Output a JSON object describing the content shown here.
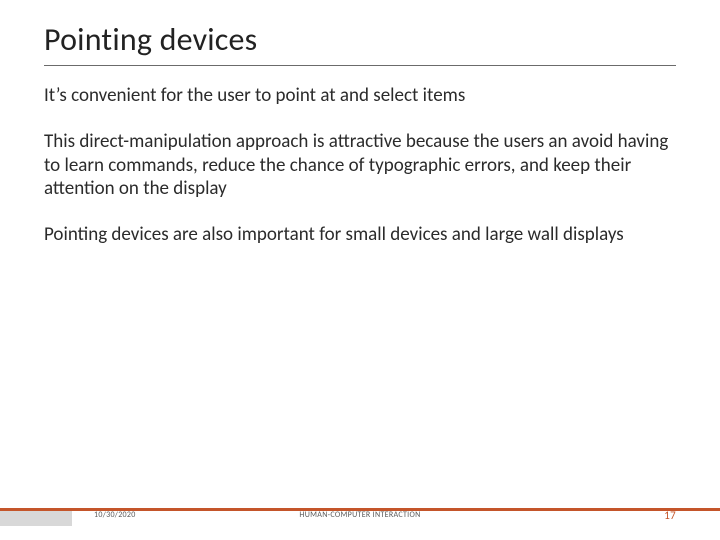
{
  "title": "Pointing devices",
  "body": {
    "p1": "It’s convenient for the user to point at and select items",
    "p2": "This direct-manipulation approach is attractive because the users an avoid having to learn commands, reduce the chance of typographic errors, and keep their attention on the display",
    "p3": "Pointing devices are also important for small devices and large wall displays"
  },
  "footer": {
    "date": "10/30/2020",
    "course": "HUMAN-COMPUTER INTERACTION",
    "page": "17"
  },
  "accent_color": "#c4552a"
}
